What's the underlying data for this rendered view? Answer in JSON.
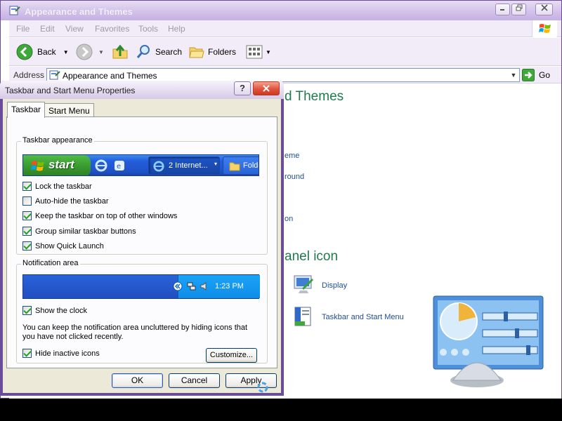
{
  "explorer": {
    "title": "Appearance and Themes",
    "menu": [
      "File",
      "Edit",
      "View",
      "Favorites",
      "Tools",
      "Help"
    ],
    "toolbar": {
      "back": "Back",
      "search": "Search",
      "folders": "Folders"
    },
    "address": {
      "label": "Address",
      "value": "Appearance and Themes",
      "go": "Go"
    },
    "content": {
      "heading1_partial": "d Themes",
      "heading2_partial": "anel icon",
      "task_fragments": [
        "eme",
        "round",
        "on"
      ],
      "cp_links": [
        "Display",
        "Taskbar and Start Menu"
      ]
    }
  },
  "dialog": {
    "title": "Taskbar and Start Menu Properties",
    "help": "?",
    "tabs": [
      "Taskbar",
      "Start Menu"
    ],
    "taskbar_appearance": {
      "label": "Taskbar appearance",
      "preview": {
        "start": "start",
        "window_button": "2 Internet...",
        "folder_button": "Folde"
      },
      "options": [
        {
          "label": "Lock the taskbar",
          "checked": true
        },
        {
          "label": "Auto-hide the taskbar",
          "checked": false
        },
        {
          "label": "Keep the taskbar on top of other windows",
          "checked": true
        },
        {
          "label": "Group similar taskbar buttons",
          "checked": true
        },
        {
          "label": "Show Quick Launch",
          "checked": true
        }
      ]
    },
    "notification_area": {
      "label": "Notification area",
      "clock": "1:23 PM",
      "show_clock": {
        "label": "Show the clock",
        "checked": true
      },
      "description": "You can keep the notification area uncluttered by hiding icons that you have not clicked recently.",
      "hide_inactive": {
        "label": "Hide inactive icons",
        "checked": true
      },
      "customize": "Customize..."
    },
    "buttons": {
      "ok": "OK",
      "cancel": "Cancel",
      "apply": "Apply"
    }
  },
  "colors": {
    "heading": "#1f7a4e",
    "link": "#1e4c9a",
    "dialog_frame": "#6a4d9a",
    "titlebar": "#d2c0ea"
  }
}
